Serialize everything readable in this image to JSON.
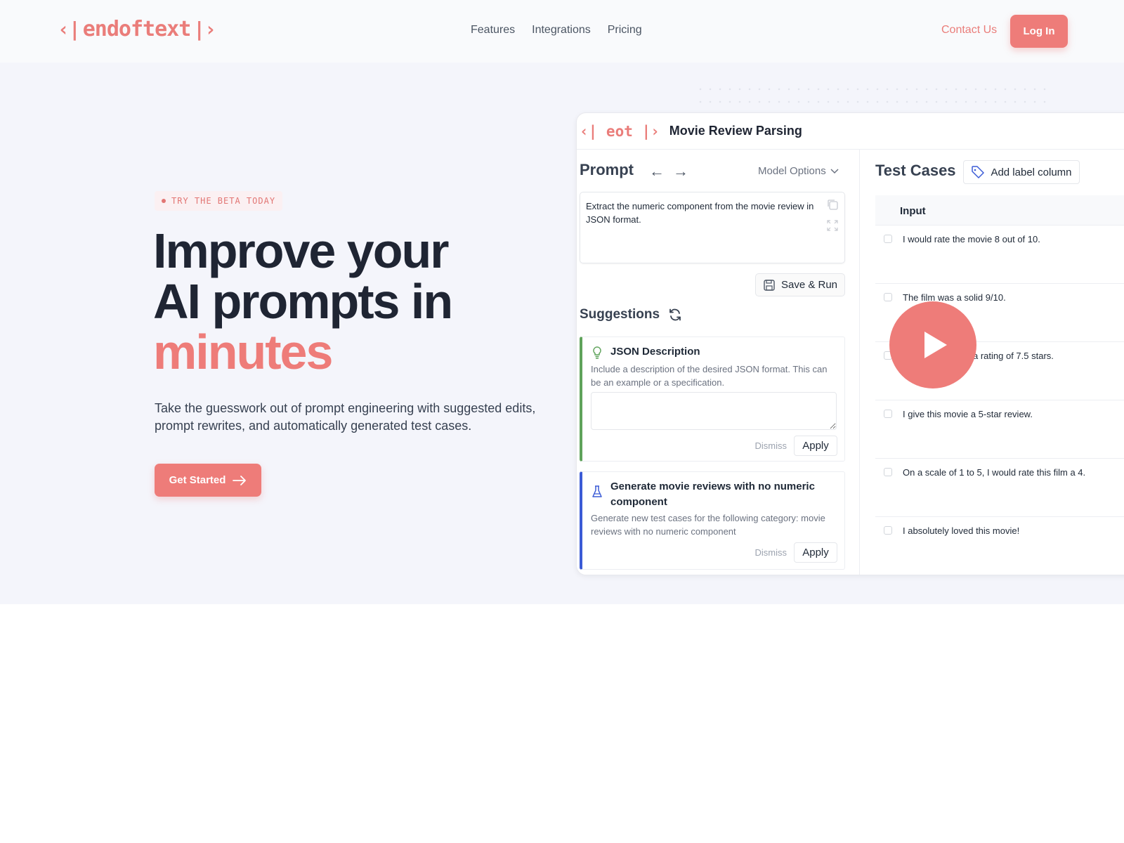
{
  "header": {
    "logo_text": "endoftext",
    "logo_left": "‹|",
    "logo_right": "|›",
    "nav": [
      "Features",
      "Integrations",
      "Pricing"
    ],
    "contact_label": "Contact Us",
    "login_label": "Log In"
  },
  "hero": {
    "badge": "TRY THE BETA TODAY",
    "headline_line1": "Improve your",
    "headline_line2": "AI prompts in",
    "headline_accent": "minutes",
    "subtext": "Take the guesswork out of prompt engineering with suggested edits, prompt rewrites, and automatically generated test cases.",
    "cta_label": "Get Started",
    "cta_icon": "arrow-right-icon"
  },
  "app": {
    "logo_text": "‹| eot |›",
    "title": "Movie Review Parsing",
    "prompt": {
      "title": "Prompt",
      "back_icon": "←",
      "forward_icon": "→",
      "model_options_label": "Model Options",
      "text": "Extract the numeric component from the movie review in JSON format.",
      "save_run_label": "Save & Run"
    },
    "suggestions": {
      "title": "Suggestions",
      "items": [
        {
          "icon": "lightbulb-icon",
          "title": "JSON Description",
          "description": "Include a description of the desired JSON format. This can be an example or a specification.",
          "input_value": "",
          "dismiss_label": "Dismiss",
          "apply_label": "Apply",
          "accent": "#5fa35b"
        },
        {
          "icon": "flask-icon",
          "title": "Generate movie reviews with no numeric component",
          "description": "Generate new test cases for the following category: movie reviews with no numeric component",
          "dismiss_label": "Dismiss",
          "apply_label": "Apply",
          "accent": "#3b5bd6"
        }
      ]
    },
    "test_cases": {
      "title": "Test Cases",
      "add_label_button": "Add label column",
      "column_header": "Input",
      "rows": [
        "I would rate the movie 8 out of 10.",
        "The film was a solid 9/10.",
        "...rves a rating of 7.5 stars.",
        "I give this movie a 5-star review.",
        "On a scale of 1 to 5, I would rate this film a 4.",
        "I absolutely loved this movie!"
      ]
    }
  },
  "colors": {
    "brand": "#ee7c79",
    "text_dark": "#1f2533",
    "hero_bg": "#f4f5fb"
  }
}
